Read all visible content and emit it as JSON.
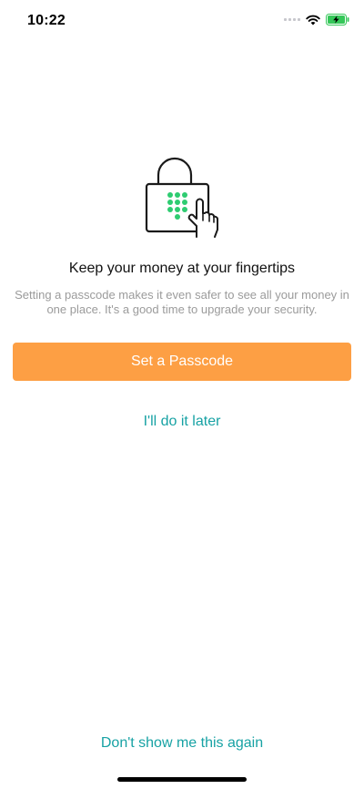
{
  "status_bar": {
    "time": "10:22",
    "icons": [
      "cellular-signal-icon",
      "wifi-icon",
      "battery-charging-icon"
    ],
    "battery_color": "#35c759"
  },
  "hero": {
    "icon": "padlock-keypad-icon",
    "accent_color": "#2ecc71"
  },
  "content": {
    "headline": "Keep your money at your fingertips",
    "description": "Setting a passcode makes it even safer to see all your money in one place. It's a good time to upgrade your security."
  },
  "actions": {
    "primary_label": "Set a Passcode",
    "primary_color": "#fd9f44",
    "later_label": "I'll do it later",
    "dont_show_label": "Don't show me this again",
    "link_color": "#17a2a4"
  }
}
